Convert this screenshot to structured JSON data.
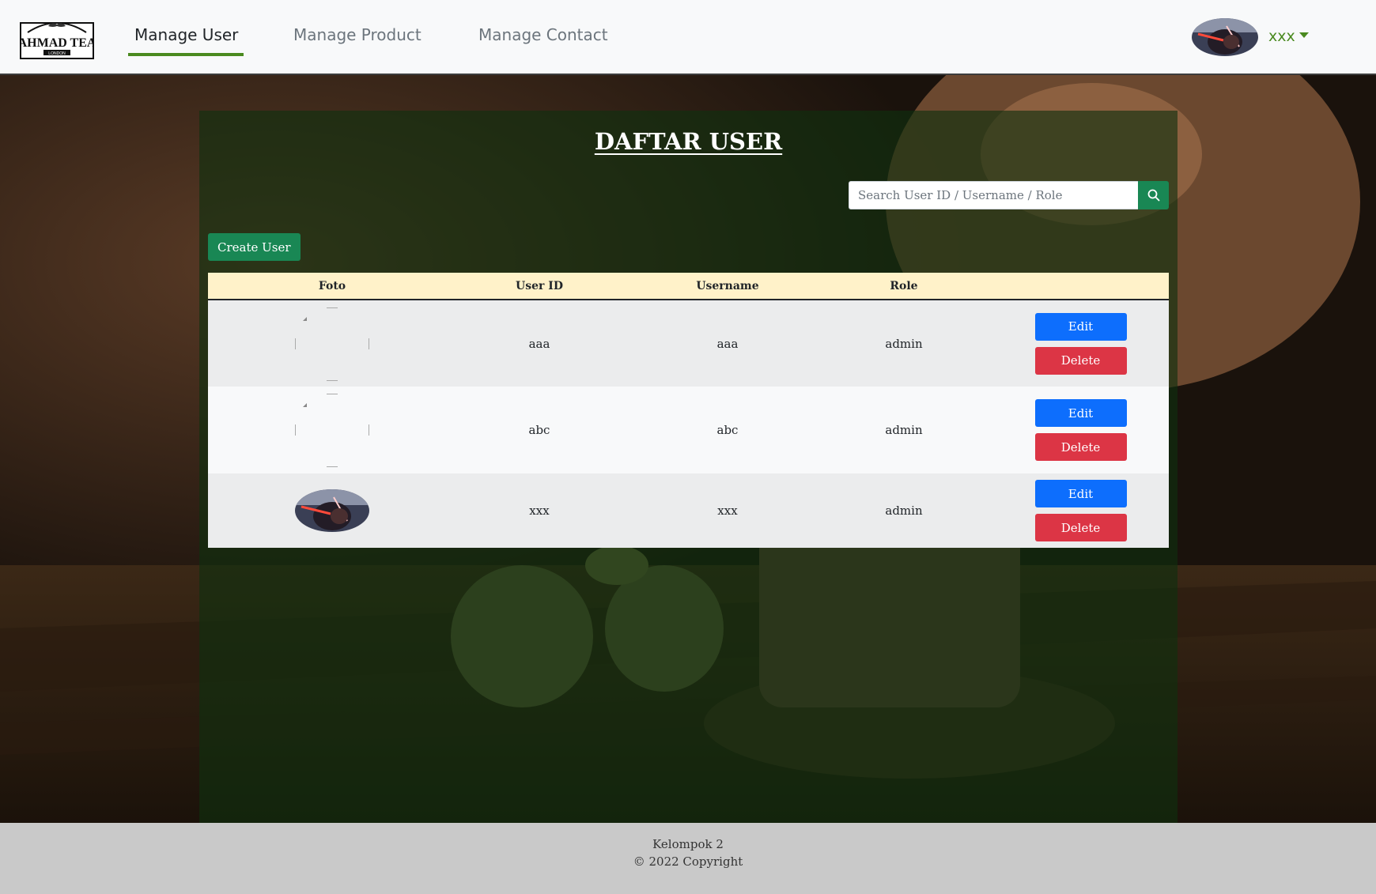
{
  "brand": {
    "logo_text": "AHMAD TEA",
    "logo_subtext": "LONDON"
  },
  "nav": {
    "items": [
      {
        "label": "Manage User",
        "active": true
      },
      {
        "label": "Manage Product",
        "active": false
      },
      {
        "label": "Manage Contact",
        "active": false
      }
    ],
    "accent_color": "#4a8a1f"
  },
  "user_menu": {
    "name": "xxx",
    "avatar_icon": "avatar-photo"
  },
  "main": {
    "title": "DAFTAR USER",
    "search": {
      "placeholder": "Search User ID / Username / Role",
      "value": "",
      "icon": "search-icon"
    },
    "create_button_label": "Create User",
    "table": {
      "headers": [
        "Foto",
        "User ID",
        "Username",
        "Role",
        ""
      ],
      "rows": [
        {
          "photo": "broken-image",
          "user_id": "aaa",
          "username": "aaa",
          "role": "admin"
        },
        {
          "photo": "broken-image",
          "user_id": "abc",
          "username": "abc",
          "role": "admin"
        },
        {
          "photo": "avatar-photo",
          "user_id": "xxx",
          "username": "xxx",
          "role": "admin"
        }
      ],
      "edit_label": "Edit",
      "delete_label": "Delete"
    }
  },
  "footer": {
    "line1": "Kelompok 2",
    "line2": "© 2022 Copyright"
  },
  "colors": {
    "success": "#198754",
    "primary": "#0d6efd",
    "danger": "#dc3545",
    "table_header_bg": "#fff2c9"
  }
}
